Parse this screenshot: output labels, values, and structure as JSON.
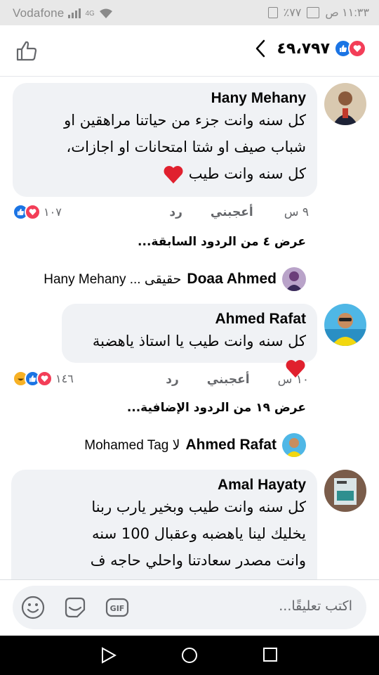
{
  "status": {
    "time": "١١:٣٣ ص",
    "battery": "٪٧٧",
    "carrier": "Vodafone",
    "network": "4G"
  },
  "header": {
    "reaction_count": "٤٩،٧٩٧"
  },
  "comments": [
    {
      "author": "Hany Mehany",
      "lines": [
        "كل سنه وانت جزء من حياتنا مراهقين او",
        "شباب صيف او شتا امتحانات او اجازات،",
        "كل سنه وانت طيب"
      ],
      "time": "٩ س",
      "like_label": "أعجبني",
      "reply_label": "رد",
      "reaction_count": "١٠٧",
      "view_replies": "عرض ٤ من الردود السابقة...",
      "reply_preview": {
        "author": "Doaa Ahmed",
        "text": "حقيقى ... Hany Mehany"
      }
    },
    {
      "author": "Ahmed Rafat",
      "lines": [
        "كل سنه وانت طيب يا استاذ ياهضبة"
      ],
      "time": "١٠ س",
      "like_label": "أعجبني",
      "reply_label": "رد",
      "reaction_count": "١٤٦",
      "view_replies": "عرض ١٩ من الردود الإضافية...",
      "reply_preview": {
        "author": "Ahmed Rafat",
        "text": "لا Mohamed Tag"
      }
    },
    {
      "author": "Amal Hayaty",
      "lines": [
        "كل سنه وانت طيب وبخير يارب ربنا",
        "يخليك لينا ياهضبه وعقبال 100 سنه",
        "وانت مصدر سعادتنا واحلي حاجه ف"
      ]
    }
  ],
  "composer": {
    "placeholder": "اكتب تعليقًا..."
  },
  "colors": {
    "like": "#1b74e4",
    "love": "#f33e58",
    "haha": "#f7b125",
    "bubble": "#f0f2f5"
  }
}
